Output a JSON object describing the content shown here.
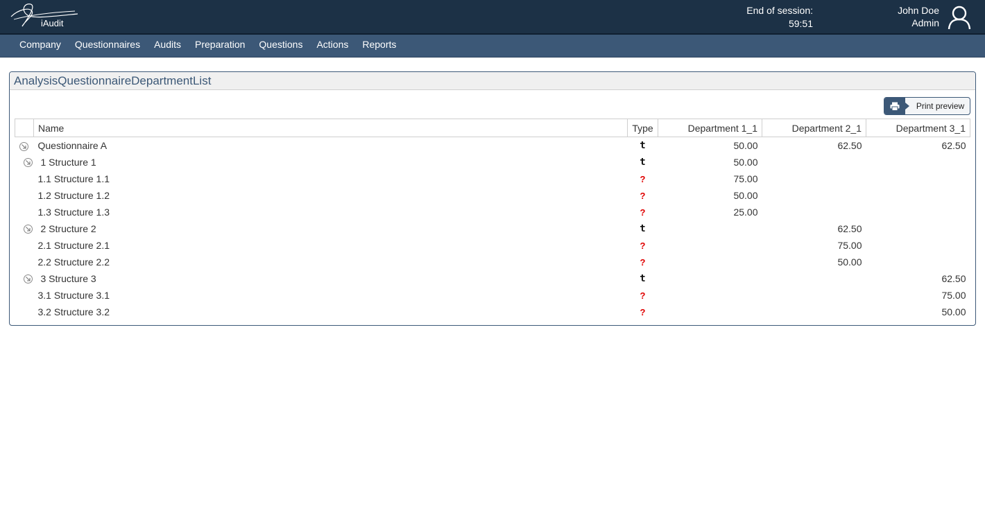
{
  "app": {
    "logo_text": "iAudit",
    "session_label": "End of session:",
    "session_time": "59:51",
    "user_name": "John Doe",
    "user_role": "Admin"
  },
  "nav": [
    "Company",
    "Questionnaires",
    "Audits",
    "Preparation",
    "Questions",
    "Actions",
    "Reports"
  ],
  "panel": {
    "title": "AnalysisQuestionnaireDepartmentList",
    "print_label": "Print preview"
  },
  "table": {
    "headers": {
      "name": "Name",
      "type": "Type",
      "dep1": "Department 1_1",
      "dep2": "Department 2_1",
      "dep3": "Department 3_1"
    },
    "type_symbols": {
      "total": "t",
      "question": "?"
    },
    "rows": [
      {
        "level": 0,
        "expander": true,
        "name": "Questionnaire A",
        "type": "total",
        "dep1": "50.00",
        "dep2": "62.50",
        "dep3": "62.50"
      },
      {
        "level": 1,
        "expander": true,
        "name": "1 Structure 1",
        "type": "total",
        "dep1": "50.00",
        "dep2": "",
        "dep3": ""
      },
      {
        "level": 2,
        "expander": false,
        "name": "1.1 Structure 1.1",
        "type": "question",
        "dep1": "75.00",
        "dep2": "",
        "dep3": ""
      },
      {
        "level": 2,
        "expander": false,
        "name": "1.2 Structure 1.2",
        "type": "question",
        "dep1": "50.00",
        "dep2": "",
        "dep3": ""
      },
      {
        "level": 2,
        "expander": false,
        "name": "1.3 Structure 1.3",
        "type": "question",
        "dep1": "25.00",
        "dep2": "",
        "dep3": ""
      },
      {
        "level": 1,
        "expander": true,
        "name": "2 Structure 2",
        "type": "total",
        "dep1": "",
        "dep2": "62.50",
        "dep3": ""
      },
      {
        "level": 2,
        "expander": false,
        "name": "2.1 Structure 2.1",
        "type": "question",
        "dep1": "",
        "dep2": "75.00",
        "dep3": ""
      },
      {
        "level": 2,
        "expander": false,
        "name": "2.2 Structure 2.2",
        "type": "question",
        "dep1": "",
        "dep2": "50.00",
        "dep3": ""
      },
      {
        "level": 1,
        "expander": true,
        "name": "3 Structure 3",
        "type": "total",
        "dep1": "",
        "dep2": "",
        "dep3": "62.50"
      },
      {
        "level": 2,
        "expander": false,
        "name": "3.1 Structure 3.1",
        "type": "question",
        "dep1": "",
        "dep2": "",
        "dep3": "75.00"
      },
      {
        "level": 2,
        "expander": false,
        "name": "3.2 Structure 3.2",
        "type": "question",
        "dep1": "",
        "dep2": "",
        "dep3": "50.00"
      }
    ]
  }
}
